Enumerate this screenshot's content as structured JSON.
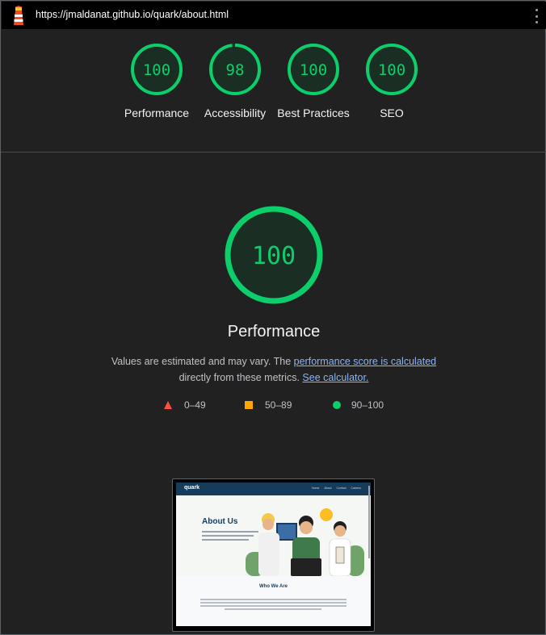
{
  "header": {
    "url": "https://jmaldanat.github.io/quark/about.html"
  },
  "gauges": [
    {
      "score": "100",
      "label": "Performance",
      "fraction": 1.0
    },
    {
      "score": "98",
      "label": "Accessibility",
      "fraction": 0.98
    },
    {
      "score": "100",
      "label": "Best Practices",
      "fraction": 1.0
    },
    {
      "score": "100",
      "label": "SEO",
      "fraction": 1.0
    }
  ],
  "performance": {
    "score": "100",
    "fraction": 1.0,
    "title": "Performance",
    "desc_prefix": "Values are estimated and may vary. The ",
    "desc_link": "performance score is calculated",
    "desc_middle": " directly from these metrics. ",
    "calc_link": "See calculator."
  },
  "legend": {
    "fail": "0–49",
    "average": "50–89",
    "pass": "90–100"
  },
  "colors": {
    "pass": "#0cce6b",
    "average": "#ffa400",
    "fail": "#ff4e42",
    "link": "#8ab4f8"
  },
  "screenshot": {
    "brand": "quark",
    "nav": [
      "Home",
      "About",
      "Contact",
      "Careers"
    ],
    "heading": "About Us",
    "section_heading": "Who We Are"
  }
}
